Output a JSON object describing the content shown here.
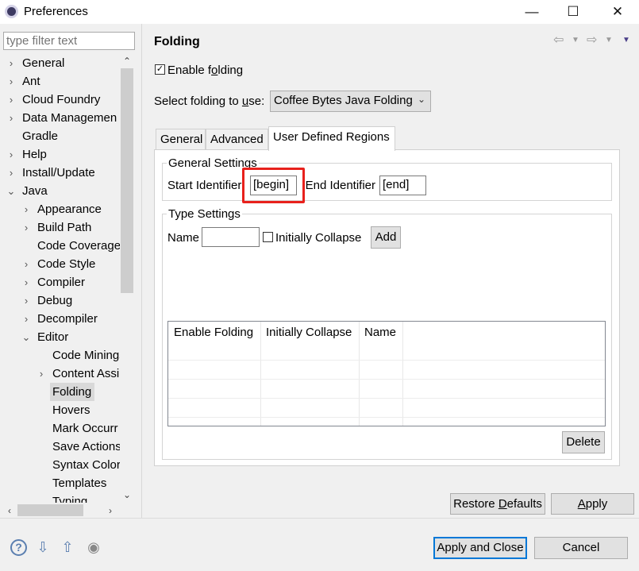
{
  "window": {
    "title": "Preferences",
    "minimize_glyph": "—",
    "maximize_glyph": "☐",
    "close_glyph": "✕"
  },
  "sidebar": {
    "filter_placeholder": "type filter text",
    "items": [
      {
        "label": "General",
        "expander": "›",
        "level": 0
      },
      {
        "label": "Ant",
        "expander": "›",
        "level": 0
      },
      {
        "label": "Cloud Foundry",
        "expander": "›",
        "level": 0
      },
      {
        "label": "Data Managemen",
        "expander": "›",
        "level": 0
      },
      {
        "label": "Gradle",
        "expander": "",
        "level": 0
      },
      {
        "label": "Help",
        "expander": "›",
        "level": 0
      },
      {
        "label": "Install/Update",
        "expander": "›",
        "level": 0
      },
      {
        "label": "Java",
        "expander": "⌄",
        "level": 0
      },
      {
        "label": "Appearance",
        "expander": "›",
        "level": 1
      },
      {
        "label": "Build Path",
        "expander": "›",
        "level": 1
      },
      {
        "label": "Code Coverage",
        "expander": "",
        "level": 1
      },
      {
        "label": "Code Style",
        "expander": "›",
        "level": 1
      },
      {
        "label": "Compiler",
        "expander": "›",
        "level": 1
      },
      {
        "label": "Debug",
        "expander": "›",
        "level": 1
      },
      {
        "label": "Decompiler",
        "expander": "›",
        "level": 1
      },
      {
        "label": "Editor",
        "expander": "⌄",
        "level": 1
      },
      {
        "label": "Code Minings",
        "expander": "",
        "level": 2
      },
      {
        "label": "Content Assi",
        "expander": "›",
        "level": 2
      },
      {
        "label": "Folding",
        "expander": "",
        "level": 2,
        "selected": true
      },
      {
        "label": "Hovers",
        "expander": "",
        "level": 2
      },
      {
        "label": "Mark Occurr",
        "expander": "",
        "level": 2
      },
      {
        "label": "Save Actions",
        "expander": "",
        "level": 2
      },
      {
        "label": "Syntax Color",
        "expander": "",
        "level": 2
      },
      {
        "label": "Templates",
        "expander": "",
        "level": 2
      },
      {
        "label": "Typing",
        "expander": "",
        "level": 2
      }
    ]
  },
  "page": {
    "title": "Folding",
    "enable_folding_pre": "Enable f",
    "enable_folding_mn": "o",
    "enable_folding_post": "lding",
    "enable_folding_checked": "✓",
    "select_label_pre": "Select folding to ",
    "select_label_mn": "u",
    "select_label_post": "se:",
    "select_value": "Coffee Bytes Java Folding",
    "tabs": [
      "General",
      "Advanced",
      "User Defined Regions"
    ],
    "general_settings": {
      "title": "General Settings",
      "start_label": "Start Identifier:",
      "start_value": "[begin]",
      "end_label": "End Identifier:",
      "end_value": "[end]"
    },
    "type_settings": {
      "title": "Type Settings",
      "name_label": "Name",
      "name_value": "",
      "initially_collapse_label": "Initially Collapse",
      "add_button": "Add",
      "table_headers": [
        "Enable Folding",
        "Initially Collapse",
        "Name"
      ],
      "delete_button": "Delete"
    },
    "restore_defaults_pre": "Restore ",
    "restore_defaults_mn": "D",
    "restore_defaults_post": "efaults",
    "apply_mn": "A",
    "apply_post": "pply"
  },
  "footer": {
    "apply_and_close": "Apply and Close",
    "cancel": "Cancel",
    "help_glyph": "?",
    "import_glyph": "⇩",
    "export_glyph": "⇧",
    "record_glyph": "◉"
  }
}
